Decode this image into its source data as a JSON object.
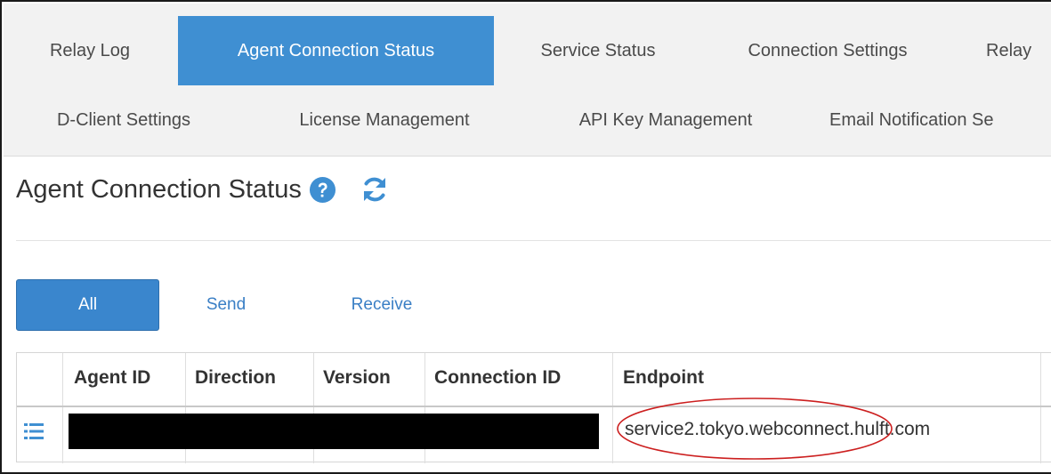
{
  "tabs": {
    "row1": [
      {
        "label": "Relay Log",
        "active": false
      },
      {
        "label": "Agent Connection Status",
        "active": true
      },
      {
        "label": "Service Status",
        "active": false
      },
      {
        "label": "Connection Settings",
        "active": false
      },
      {
        "label": "Relay",
        "active": false
      }
    ],
    "row2": [
      {
        "label": "D-Client Settings",
        "active": false
      },
      {
        "label": "License Management",
        "active": false
      },
      {
        "label": "API Key Management",
        "active": false
      },
      {
        "label": "Email Notification Se",
        "active": false
      }
    ]
  },
  "page": {
    "title": "Agent Connection Status",
    "help_icon": "question-circle-icon",
    "refresh_icon": "refresh-icon"
  },
  "filters": {
    "all": "All",
    "send": "Send",
    "receive": "Receive",
    "selected": "All"
  },
  "table": {
    "columns": [
      "Agent ID",
      "Direction",
      "Version",
      "Connection ID",
      "Endpoint"
    ],
    "rows": [
      {
        "row_icon": "list-icon",
        "agent_id": "",
        "direction": "",
        "version": "",
        "connection_id": "",
        "endpoint": "service2.tokyo.webconnect.hulft.com",
        "redacted": true
      }
    ]
  },
  "colors": {
    "accent": "#3f8fd2",
    "tab_bar_bg": "#f2f2f2",
    "link": "#3a7fc5",
    "annotation": "#cc1f1f"
  }
}
